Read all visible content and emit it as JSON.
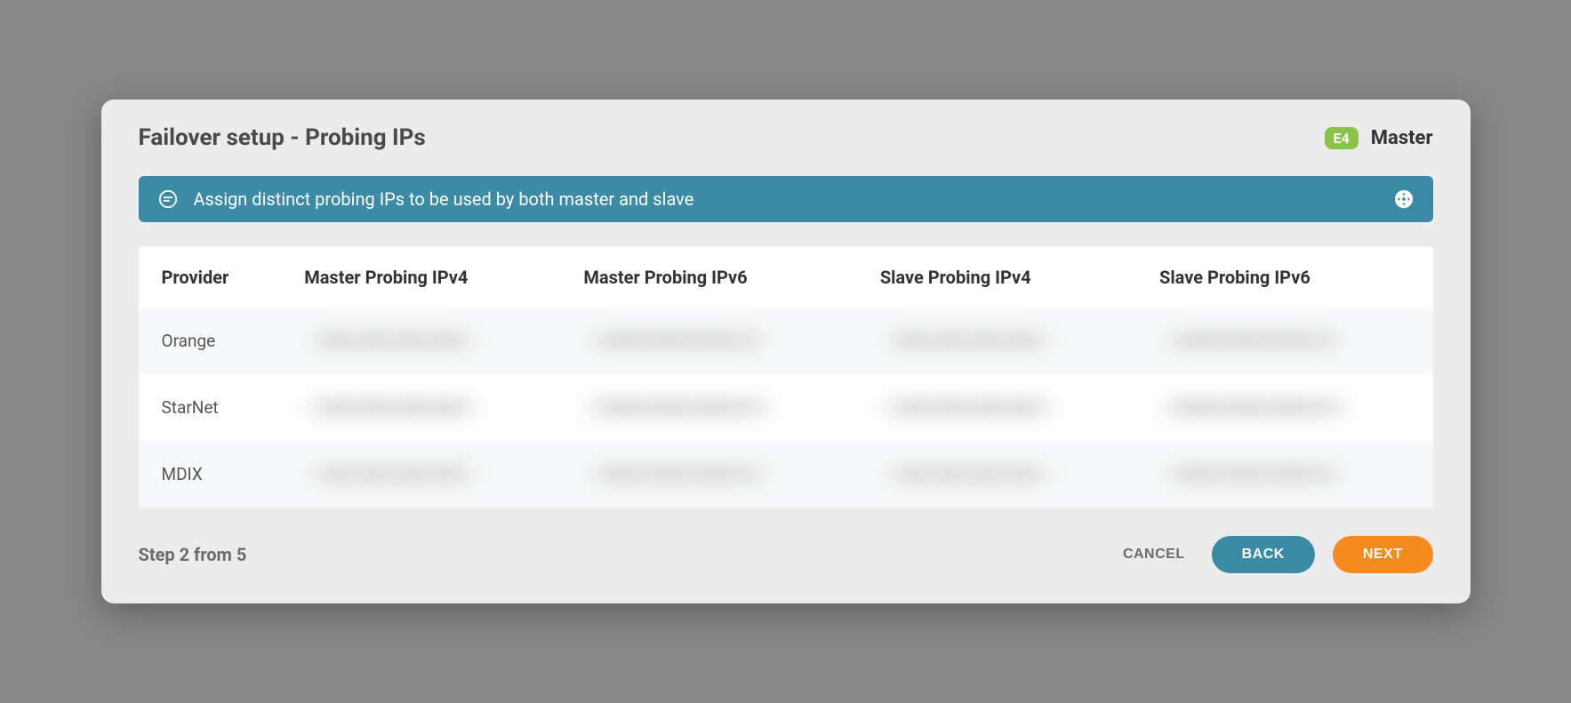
{
  "header": {
    "title": "Failover setup - Probing IPs",
    "badge": "E4",
    "role": "Master"
  },
  "banner": {
    "text": "Assign distinct probing IPs to be used by both master and slave"
  },
  "table": {
    "columns": [
      "Provider",
      "Master Probing IPv4",
      "Master Probing IPv6",
      "Slave Probing IPv4",
      "Slave Probing IPv6"
    ],
    "rows": [
      {
        "provider": "Orange",
        "master_ipv4": "XXX.XXX.XXX.XXX",
        "master_ipv6": "XXXX:XXXX:XXXX::X",
        "slave_ipv4": "XXX.XXX.XXX.XXX",
        "slave_ipv6": "XXXX:XXXX:XXXX::X"
      },
      {
        "provider": "StarNet",
        "master_ipv4": "XXX.XXX.XXX.XXX",
        "master_ipv6": "XXXX:XXXX:XXXX::X",
        "slave_ipv4": "XXX.XXX.XXX.XXX",
        "slave_ipv6": "XXXX:XXXX:XXXX::X"
      },
      {
        "provider": "MDIX",
        "master_ipv4": "XXX.XXX.XXX.XXX",
        "master_ipv6": "XXXX:XXXX:XXXX::X",
        "slave_ipv4": "XXX.XXX.XXX.XXX",
        "slave_ipv6": "XXXX:XXXX:XXXX::X"
      }
    ]
  },
  "footer": {
    "step": "Step 2 from 5",
    "cancel": "CANCEL",
    "back": "BACK",
    "next": "NEXT"
  }
}
